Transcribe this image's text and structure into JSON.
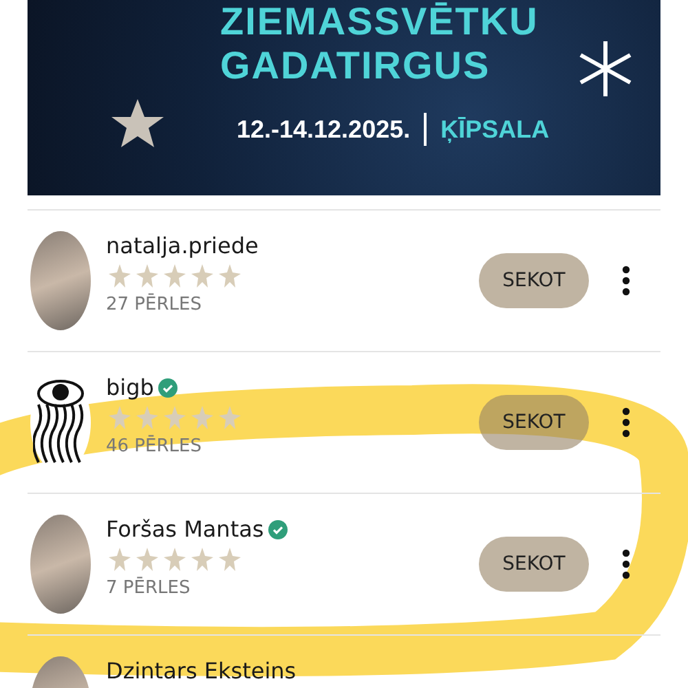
{
  "banner": {
    "title_lines": [
      "ZIEMASSVĒTKU",
      "GADATIRGUS"
    ],
    "dates": "12.-14.12.2025.",
    "venue": "ĶĪPSALA"
  },
  "users": [
    {
      "name": "natalja.priede",
      "verified": false,
      "kind": "photo",
      "pearls": "27 PĒRLES",
      "button": "SEKOT"
    },
    {
      "name": "bigb",
      "verified": true,
      "kind": "drawing",
      "pearls": "46 PĒRLES",
      "button": "SEKOT"
    },
    {
      "name": "Foršas Mantas",
      "verified": true,
      "kind": "photo",
      "pearls": "7 PĒRLES",
      "button": "SEKOT"
    },
    {
      "name": "Dzintars Eksteins",
      "verified": false,
      "kind": "photo"
    }
  ]
}
